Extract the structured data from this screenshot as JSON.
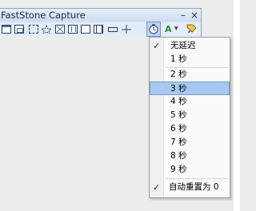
{
  "window": {
    "title": "FastStone Capture",
    "minimize_glyph": "–",
    "close_glyph": "×"
  },
  "toolbar": {
    "icons": [
      "capture-window-icon",
      "capture-object-icon",
      "capture-region-icon",
      "capture-freehand-icon",
      "capture-fullscreen-icon",
      "capture-scrolling-icon",
      "capture-fixed-region-icon",
      "record-video-icon",
      "rectangle-icon",
      "crosshair-icon",
      "delay-timer-icon",
      "output-icon",
      "settings-icon"
    ],
    "dropdown_glyph": "▾"
  },
  "delay_menu": {
    "checked_index": 0,
    "highlighted_index": 3,
    "check_glyph": "✓",
    "items": [
      "无延迟",
      "1 秒",
      "2 秒",
      "3 秒",
      "4 秒",
      "5 秒",
      "6 秒",
      "7 秒",
      "8 秒",
      "9 秒"
    ],
    "reset_label": "自动重置为 0",
    "reset_checked": true
  },
  "colors": {
    "menu_highlight": "#a7c8ef",
    "titlebar": "#cddcf0"
  }
}
